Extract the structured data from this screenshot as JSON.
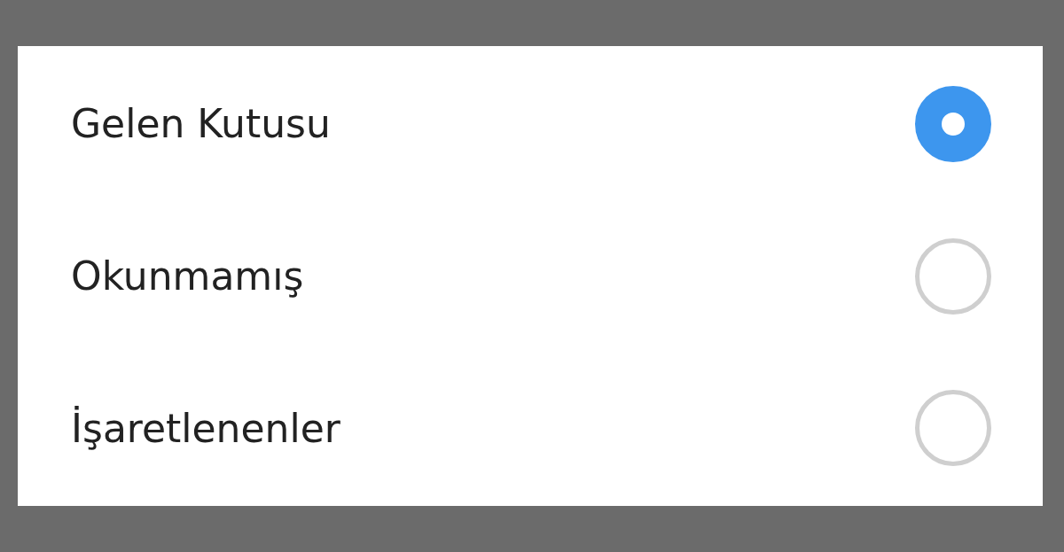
{
  "dialog": {
    "options": [
      {
        "label": "Gelen Kutusu",
        "selected": true
      },
      {
        "label": "Okunmamış",
        "selected": false
      },
      {
        "label": "İşaretlenenler",
        "selected": false
      }
    ]
  }
}
